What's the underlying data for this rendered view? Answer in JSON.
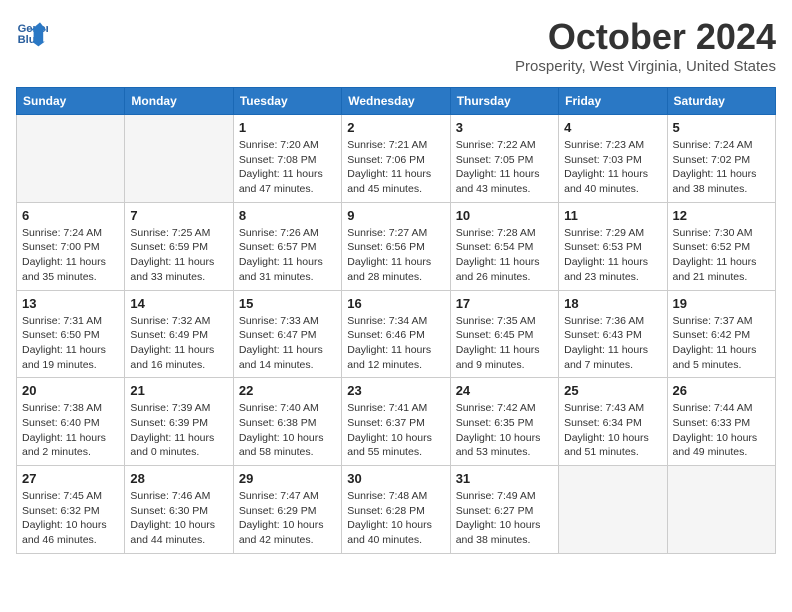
{
  "header": {
    "logo_line1": "General",
    "logo_line2": "Blue",
    "month_title": "October 2024",
    "location": "Prosperity, West Virginia, United States"
  },
  "days_of_week": [
    "Sunday",
    "Monday",
    "Tuesday",
    "Wednesday",
    "Thursday",
    "Friday",
    "Saturday"
  ],
  "weeks": [
    [
      {
        "day": "",
        "info": ""
      },
      {
        "day": "",
        "info": ""
      },
      {
        "day": "1",
        "sunrise": "Sunrise: 7:20 AM",
        "sunset": "Sunset: 7:08 PM",
        "daylight": "Daylight: 11 hours and 47 minutes."
      },
      {
        "day": "2",
        "sunrise": "Sunrise: 7:21 AM",
        "sunset": "Sunset: 7:06 PM",
        "daylight": "Daylight: 11 hours and 45 minutes."
      },
      {
        "day": "3",
        "sunrise": "Sunrise: 7:22 AM",
        "sunset": "Sunset: 7:05 PM",
        "daylight": "Daylight: 11 hours and 43 minutes."
      },
      {
        "day": "4",
        "sunrise": "Sunrise: 7:23 AM",
        "sunset": "Sunset: 7:03 PM",
        "daylight": "Daylight: 11 hours and 40 minutes."
      },
      {
        "day": "5",
        "sunrise": "Sunrise: 7:24 AM",
        "sunset": "Sunset: 7:02 PM",
        "daylight": "Daylight: 11 hours and 38 minutes."
      }
    ],
    [
      {
        "day": "6",
        "sunrise": "Sunrise: 7:24 AM",
        "sunset": "Sunset: 7:00 PM",
        "daylight": "Daylight: 11 hours and 35 minutes."
      },
      {
        "day": "7",
        "sunrise": "Sunrise: 7:25 AM",
        "sunset": "Sunset: 6:59 PM",
        "daylight": "Daylight: 11 hours and 33 minutes."
      },
      {
        "day": "8",
        "sunrise": "Sunrise: 7:26 AM",
        "sunset": "Sunset: 6:57 PM",
        "daylight": "Daylight: 11 hours and 31 minutes."
      },
      {
        "day": "9",
        "sunrise": "Sunrise: 7:27 AM",
        "sunset": "Sunset: 6:56 PM",
        "daylight": "Daylight: 11 hours and 28 minutes."
      },
      {
        "day": "10",
        "sunrise": "Sunrise: 7:28 AM",
        "sunset": "Sunset: 6:54 PM",
        "daylight": "Daylight: 11 hours and 26 minutes."
      },
      {
        "day": "11",
        "sunrise": "Sunrise: 7:29 AM",
        "sunset": "Sunset: 6:53 PM",
        "daylight": "Daylight: 11 hours and 23 minutes."
      },
      {
        "day": "12",
        "sunrise": "Sunrise: 7:30 AM",
        "sunset": "Sunset: 6:52 PM",
        "daylight": "Daylight: 11 hours and 21 minutes."
      }
    ],
    [
      {
        "day": "13",
        "sunrise": "Sunrise: 7:31 AM",
        "sunset": "Sunset: 6:50 PM",
        "daylight": "Daylight: 11 hours and 19 minutes."
      },
      {
        "day": "14",
        "sunrise": "Sunrise: 7:32 AM",
        "sunset": "Sunset: 6:49 PM",
        "daylight": "Daylight: 11 hours and 16 minutes."
      },
      {
        "day": "15",
        "sunrise": "Sunrise: 7:33 AM",
        "sunset": "Sunset: 6:47 PM",
        "daylight": "Daylight: 11 hours and 14 minutes."
      },
      {
        "day": "16",
        "sunrise": "Sunrise: 7:34 AM",
        "sunset": "Sunset: 6:46 PM",
        "daylight": "Daylight: 11 hours and 12 minutes."
      },
      {
        "day": "17",
        "sunrise": "Sunrise: 7:35 AM",
        "sunset": "Sunset: 6:45 PM",
        "daylight": "Daylight: 11 hours and 9 minutes."
      },
      {
        "day": "18",
        "sunrise": "Sunrise: 7:36 AM",
        "sunset": "Sunset: 6:43 PM",
        "daylight": "Daylight: 11 hours and 7 minutes."
      },
      {
        "day": "19",
        "sunrise": "Sunrise: 7:37 AM",
        "sunset": "Sunset: 6:42 PM",
        "daylight": "Daylight: 11 hours and 5 minutes."
      }
    ],
    [
      {
        "day": "20",
        "sunrise": "Sunrise: 7:38 AM",
        "sunset": "Sunset: 6:40 PM",
        "daylight": "Daylight: 11 hours and 2 minutes."
      },
      {
        "day": "21",
        "sunrise": "Sunrise: 7:39 AM",
        "sunset": "Sunset: 6:39 PM",
        "daylight": "Daylight: 11 hours and 0 minutes."
      },
      {
        "day": "22",
        "sunrise": "Sunrise: 7:40 AM",
        "sunset": "Sunset: 6:38 PM",
        "daylight": "Daylight: 10 hours and 58 minutes."
      },
      {
        "day": "23",
        "sunrise": "Sunrise: 7:41 AM",
        "sunset": "Sunset: 6:37 PM",
        "daylight": "Daylight: 10 hours and 55 minutes."
      },
      {
        "day": "24",
        "sunrise": "Sunrise: 7:42 AM",
        "sunset": "Sunset: 6:35 PM",
        "daylight": "Daylight: 10 hours and 53 minutes."
      },
      {
        "day": "25",
        "sunrise": "Sunrise: 7:43 AM",
        "sunset": "Sunset: 6:34 PM",
        "daylight": "Daylight: 10 hours and 51 minutes."
      },
      {
        "day": "26",
        "sunrise": "Sunrise: 7:44 AM",
        "sunset": "Sunset: 6:33 PM",
        "daylight": "Daylight: 10 hours and 49 minutes."
      }
    ],
    [
      {
        "day": "27",
        "sunrise": "Sunrise: 7:45 AM",
        "sunset": "Sunset: 6:32 PM",
        "daylight": "Daylight: 10 hours and 46 minutes."
      },
      {
        "day": "28",
        "sunrise": "Sunrise: 7:46 AM",
        "sunset": "Sunset: 6:30 PM",
        "daylight": "Daylight: 10 hours and 44 minutes."
      },
      {
        "day": "29",
        "sunrise": "Sunrise: 7:47 AM",
        "sunset": "Sunset: 6:29 PM",
        "daylight": "Daylight: 10 hours and 42 minutes."
      },
      {
        "day": "30",
        "sunrise": "Sunrise: 7:48 AM",
        "sunset": "Sunset: 6:28 PM",
        "daylight": "Daylight: 10 hours and 40 minutes."
      },
      {
        "day": "31",
        "sunrise": "Sunrise: 7:49 AM",
        "sunset": "Sunset: 6:27 PM",
        "daylight": "Daylight: 10 hours and 38 minutes."
      },
      {
        "day": "",
        "info": ""
      },
      {
        "day": "",
        "info": ""
      }
    ]
  ]
}
